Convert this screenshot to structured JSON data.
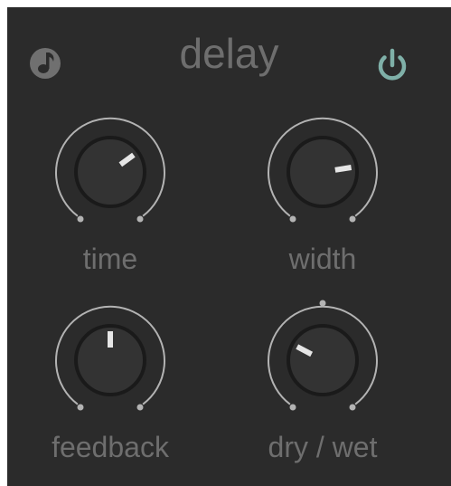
{
  "panel": {
    "title": "delay",
    "sync_icon": "note-icon",
    "power_icon": "power-icon",
    "colors": {
      "background": "#2b2b2b",
      "text": "#6e6e6e",
      "power_accent": "#7fb0a8",
      "knob_body": "#333333",
      "indicator": "#e6e6e6"
    }
  },
  "knobs": [
    {
      "label": "time",
      "value": 0.7
    },
    {
      "label": "width",
      "value": 0.8
    },
    {
      "label": "feedback",
      "value": 0.5
    },
    {
      "label": "dry / wet",
      "value": 0.27
    }
  ]
}
